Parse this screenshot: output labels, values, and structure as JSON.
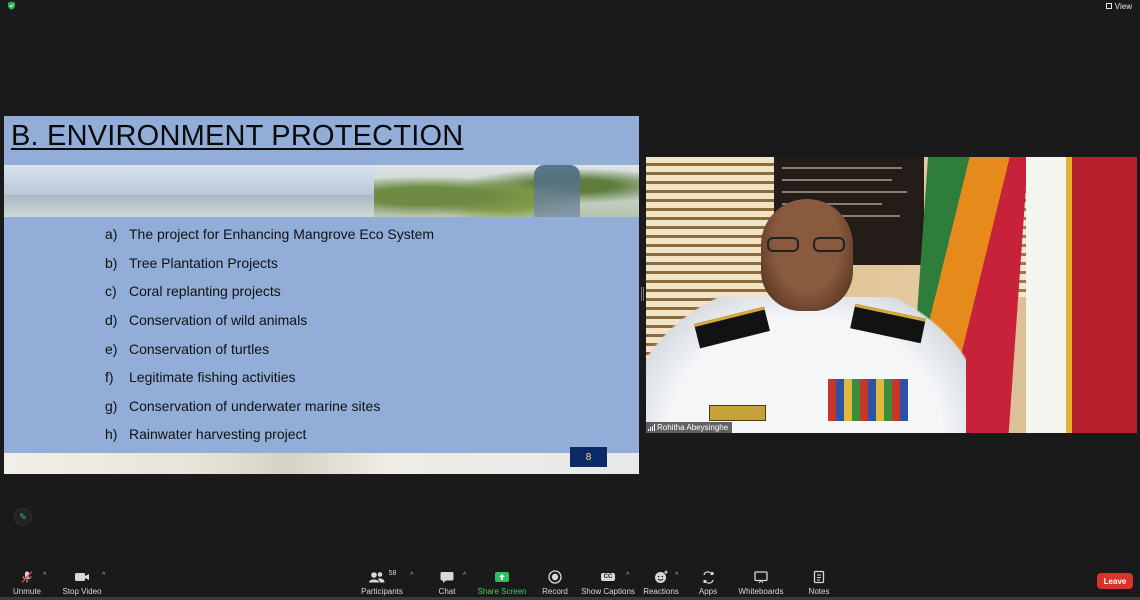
{
  "window": {
    "view_label": "View"
  },
  "slide": {
    "title": "B. ENVIRONMENT PROTECTION",
    "items": [
      {
        "marker": "a)",
        "text": "The project for Enhancing Mangrove Eco System"
      },
      {
        "marker": "b)",
        "text": "Tree Plantation Projects"
      },
      {
        "marker": "c)",
        "text": "Coral replanting projects"
      },
      {
        "marker": "d)",
        "text": "Conservation of wild animals"
      },
      {
        "marker": "e)",
        "text": "Conservation of turtles"
      },
      {
        "marker": "f)",
        "text": "Legitimate fishing activities"
      },
      {
        "marker": "g)",
        "text": "Conservation of underwater marine sites"
      },
      {
        "marker": "h)",
        "text": "Rainwater harvesting project"
      }
    ],
    "page_number": "8"
  },
  "participant": {
    "name": "Rohitha Abeysinghe"
  },
  "toolbar": {
    "unmute": "Unmute",
    "stop_video": "Stop Video",
    "participants": "Participants",
    "participants_count": "58",
    "chat": "Chat",
    "share_screen": "Share Screen",
    "record": "Record",
    "show_captions": "Show Captions",
    "captions_icon_text": "CC",
    "reactions": "Reactions",
    "apps": "Apps",
    "whiteboards": "Whiteboards",
    "notes": "Notes",
    "leave": "Leave"
  },
  "colors": {
    "slide_bg": "#92aed8",
    "page_badge_bg": "#0c2a68",
    "page_badge_text": "#f6e27a",
    "share_green": "#3ecf6a",
    "leave_red": "#d9342b",
    "app_bg": "#1a1a1a"
  },
  "icons": {
    "security": "shield-icon",
    "view": "grid-icon",
    "annotate": "pencil-icon",
    "mic": "mic-muted-icon",
    "video": "video-camera-icon",
    "participants": "people-icon",
    "chat": "chat-bubble-icon",
    "share": "share-arrow-icon",
    "record": "record-icon",
    "captions": "cc-icon",
    "reactions": "smiley-plus-icon",
    "apps": "apps-icon",
    "whiteboards": "whiteboard-icon",
    "notes": "notes-icon",
    "caret": "caret-up-icon"
  }
}
